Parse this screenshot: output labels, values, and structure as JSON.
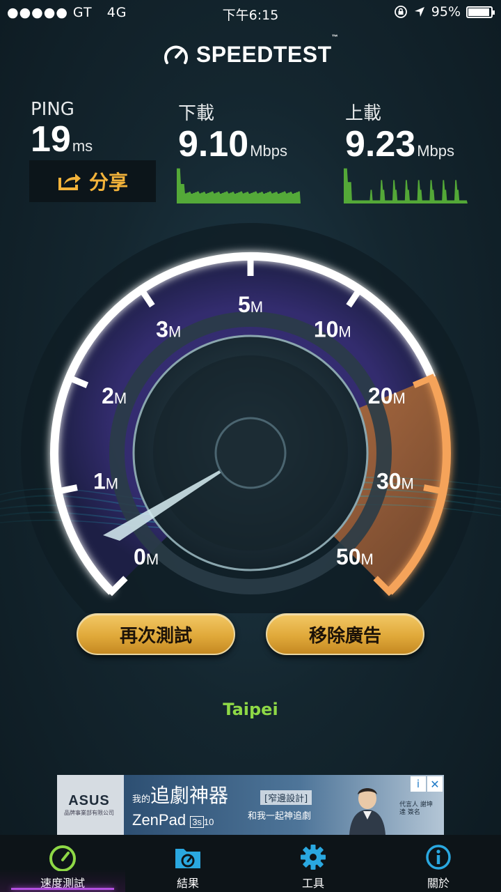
{
  "status_bar": {
    "carrier": "●●●●● GT",
    "network": "4G",
    "time": "下午6:15",
    "battery": "95%",
    "battery_level": 0.95
  },
  "app": {
    "title": "SPEEDTEST",
    "trademark": "™"
  },
  "metrics": {
    "ping": {
      "label": "PING",
      "value": "19",
      "unit": "ms"
    },
    "download": {
      "label": "下載",
      "value": "9.10",
      "unit": "Mbps"
    },
    "upload": {
      "label": "上載",
      "value": "9.23",
      "unit": "Mbps"
    }
  },
  "share_label": "分享",
  "gauge": {
    "ticks": [
      {
        "num": "0",
        "unit": "M"
      },
      {
        "num": "1",
        "unit": "M"
      },
      {
        "num": "2",
        "unit": "M"
      },
      {
        "num": "3",
        "unit": "M"
      },
      {
        "num": "5",
        "unit": "M"
      },
      {
        "num": "10",
        "unit": "M"
      },
      {
        "num": "20",
        "unit": "M"
      },
      {
        "num": "30",
        "unit": "M"
      },
      {
        "num": "50",
        "unit": "M"
      }
    ],
    "needle_value_mbps": 0
  },
  "buttons": {
    "retest": "再次測試",
    "remove_ads": "移除廣告"
  },
  "server_city": "Taipei",
  "ad": {
    "brand": "ASUS",
    "brand_sub": "品牌事業部有限公司",
    "headline_small": "我的",
    "headline": "追劇神器",
    "product": "ZenPad",
    "product_model": "3s",
    "product_size": "10",
    "design_tag": "[窄邊設計]",
    "slogan": "和我一起神追劇",
    "side_note": "代言人 謝坤達 簽名",
    "info_icon": "i",
    "close_icon": "✕"
  },
  "tabs": [
    {
      "label": "速度測試",
      "icon": "speedometer-icon",
      "active": true
    },
    {
      "label": "結果",
      "icon": "results-folder-icon",
      "active": false
    },
    {
      "label": "工具",
      "icon": "gear-icon",
      "active": false
    },
    {
      "label": "關於",
      "icon": "info-icon",
      "active": false
    }
  ],
  "colors": {
    "accent_gold": "#f3b33a",
    "city_green": "#8ed846",
    "tab_active": "#b34fe0",
    "sparkline_green": "#5fbf3a"
  }
}
